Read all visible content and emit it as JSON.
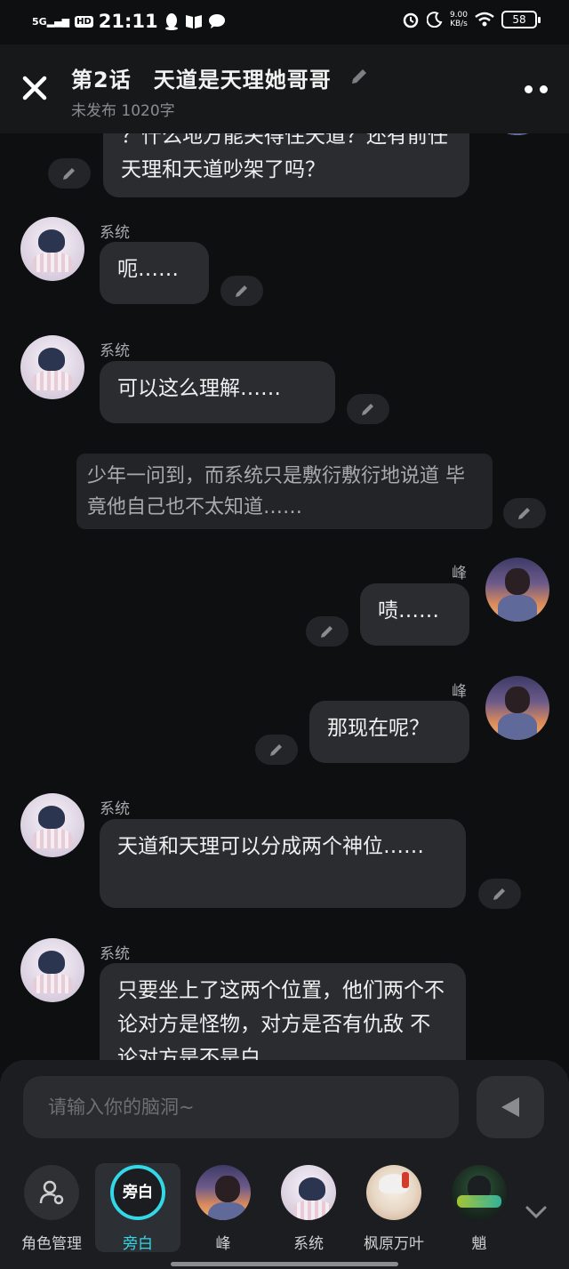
{
  "status_bar": {
    "network": "5G",
    "hd": "HD",
    "time": "21:11",
    "speed_value": "9.00",
    "speed_unit": "KB/s",
    "battery": "58"
  },
  "header": {
    "title": "第2话　天道是天理她哥哥",
    "subtitle": "未发布 1020字"
  },
  "messages": [
    {
      "role": "system-partial",
      "text": "？什么地方能关得住天道？还有前任天理和天道吵架了吗？"
    },
    {
      "role": "system",
      "name": "系统",
      "text": "呃……"
    },
    {
      "role": "system",
      "name": "系统",
      "text": "可以这么理解……"
    },
    {
      "role": "narration",
      "text": "少年一问到，而系统只是敷衍敷衍地说道 毕竟他自己也不太知道……"
    },
    {
      "role": "user",
      "name": "峰",
      "text": "啧……"
    },
    {
      "role": "user",
      "name": "峰",
      "text": "那现在呢？"
    },
    {
      "role": "system",
      "name": "系统",
      "text": "天道和天理可以分成两个神位……"
    },
    {
      "role": "system",
      "name": "系统",
      "text": "只要坐上了这两个位置，他们两个不论对方是怪物，对方是否有仇敌 不论对方是不是白"
    }
  ],
  "input": {
    "placeholder": "请输入你的脑洞~"
  },
  "roles": [
    {
      "label": "角色管理",
      "icon": "role-manage-icon"
    },
    {
      "label": "旁白",
      "icon_text": "旁白",
      "active": true
    },
    {
      "label": "峰"
    },
    {
      "label": "系统"
    },
    {
      "label": "枫原万叶"
    },
    {
      "label": "魈"
    }
  ],
  "colors": {
    "accent": "#34d7e6",
    "background": "#0e0f11",
    "bubble": "#2a2c30"
  }
}
